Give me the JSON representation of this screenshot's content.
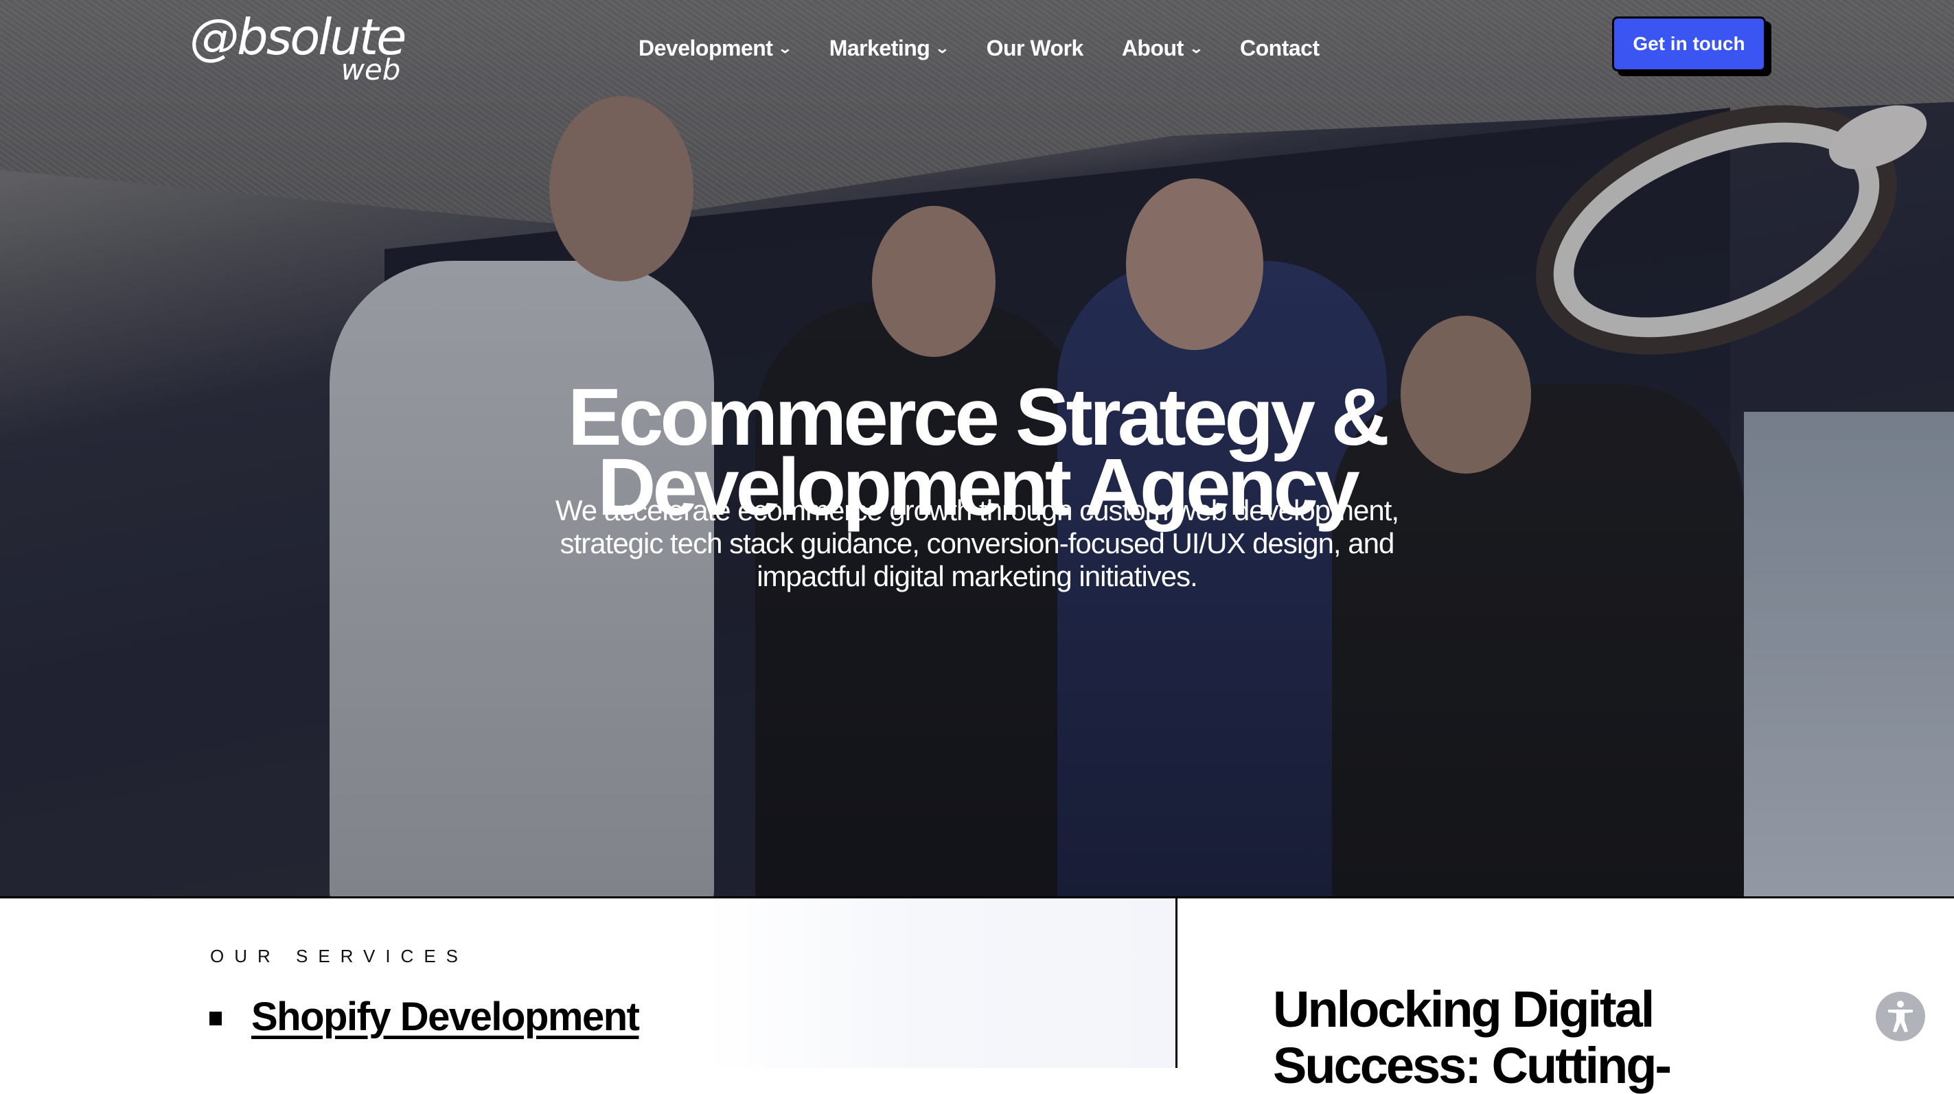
{
  "nav": {
    "logo": {
      "main": "@bsolute",
      "sub": "web"
    },
    "items": [
      {
        "label": "Development",
        "has_dropdown": true
      },
      {
        "label": "Marketing",
        "has_dropdown": true
      },
      {
        "label": "Our Work",
        "has_dropdown": false
      },
      {
        "label": "About",
        "has_dropdown": true
      },
      {
        "label": "Contact",
        "has_dropdown": false
      }
    ],
    "chevron_glyph": "⌄",
    "cta_label": "Get in touch"
  },
  "hero": {
    "headline_line1": "Ecommerce Strategy &",
    "headline_line2": "Development Agency",
    "subheadline": "We accelerate ecommerce growth through custom web development, strategic tech stack guidance, conversion-focused UI/UX design, and impactful digital marketing initiatives."
  },
  "services": {
    "eyebrow": "OUR SERVICES",
    "items": [
      {
        "label": "Shopify Development"
      }
    ]
  },
  "article": {
    "title": "Unlocking Digital Success: Cutting-"
  },
  "accessibility": {
    "icon": "accessibility-icon"
  },
  "colors": {
    "cta": "#3a55f2",
    "text_dark": "#000000",
    "hero_text": "#ffffff"
  }
}
